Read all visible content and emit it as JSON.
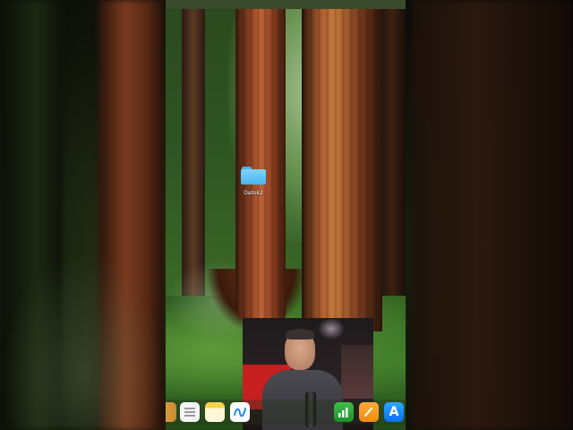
{
  "desktop": {
    "folder": {
      "label": "Datok2",
      "icon": "folder-icon"
    }
  },
  "dock": {
    "apps": [
      {
        "name": "finder",
        "icon": "finder-icon"
      },
      {
        "name": "reminders",
        "icon": "reminders-icon"
      },
      {
        "name": "notes",
        "icon": "notes-icon"
      },
      {
        "name": "freeform",
        "icon": "freeform-icon"
      },
      {
        "name": "numbers",
        "icon": "numbers-icon"
      },
      {
        "name": "pages",
        "icon": "pages-icon"
      },
      {
        "name": "app-store",
        "icon": "app-store-icon",
        "glyph": "A"
      }
    ]
  },
  "colors": {
    "folder_blue": "#48b4ec",
    "dock_accent_pages": "#f08a12",
    "dock_accent_numbers": "#1f8f2a",
    "dock_accent_appstore": "#0b6ff0"
  }
}
